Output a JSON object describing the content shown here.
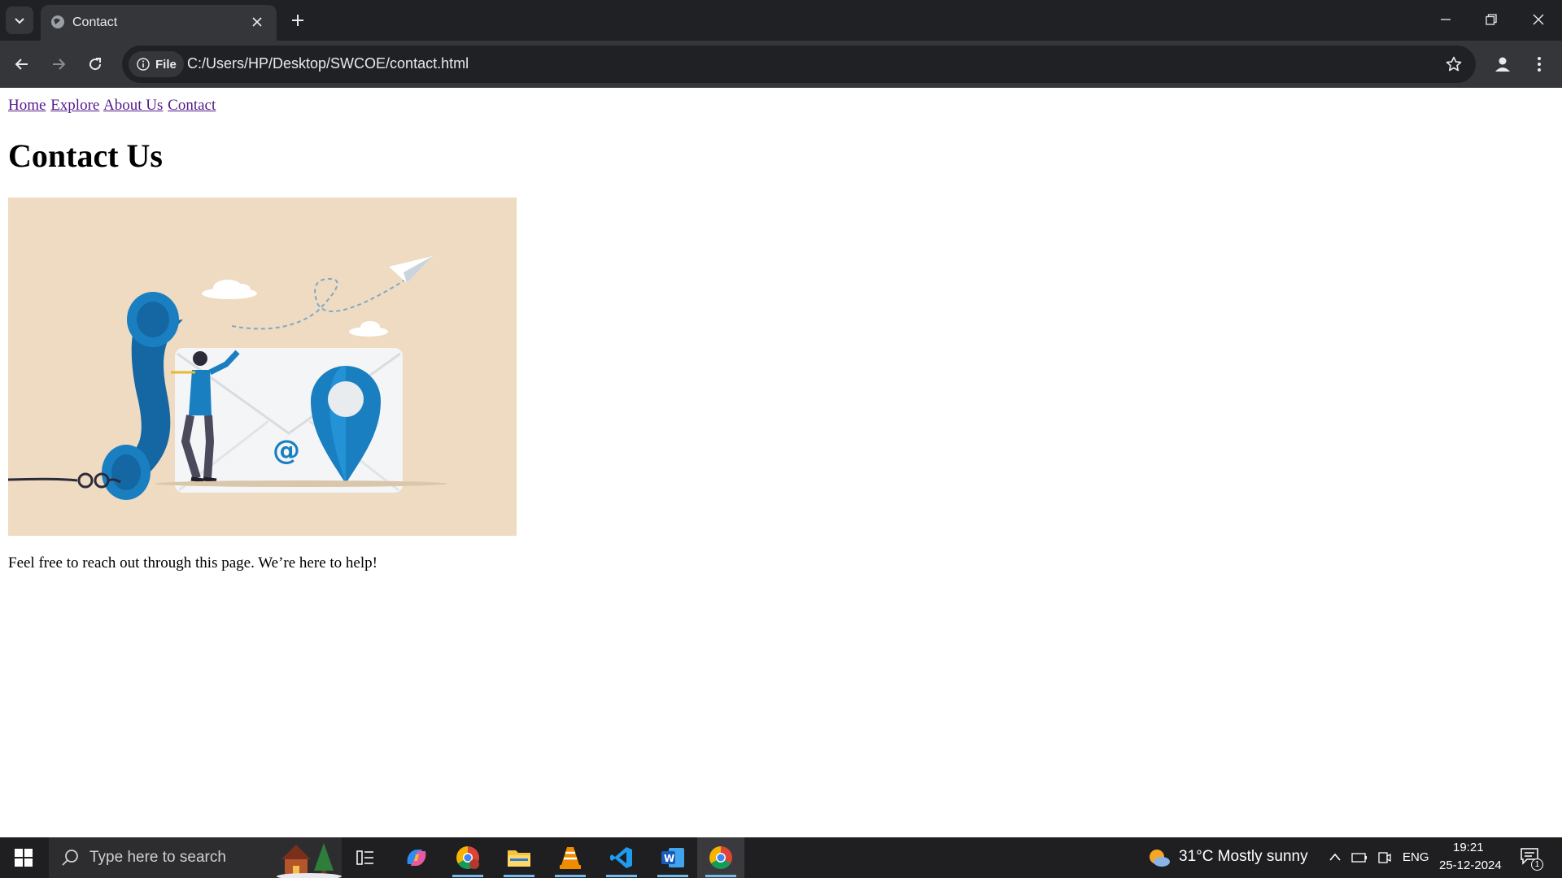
{
  "browser": {
    "tab_title": "Contact",
    "url": "C:/Users/HP/Desktop/SWCOE/contact.html",
    "site_info_label": "File"
  },
  "page": {
    "nav_links": [
      "Home",
      "Explore",
      "About Us",
      "Contact"
    ],
    "heading": "Contact Us",
    "image_alt": "contact illustration",
    "intro": "Feel free to reach out through this page. We’re here to help!"
  },
  "taskbar": {
    "search_placeholder": "Type here to search",
    "weather": "31°C  Mostly sunny",
    "language": "ENG",
    "time": "19:21",
    "date": "25-12-2024",
    "notification_count": "1"
  },
  "colors": {
    "link": "#551a8b",
    "hero_bg": "#eedbc1",
    "accent_blue": "#1a7fc1"
  }
}
